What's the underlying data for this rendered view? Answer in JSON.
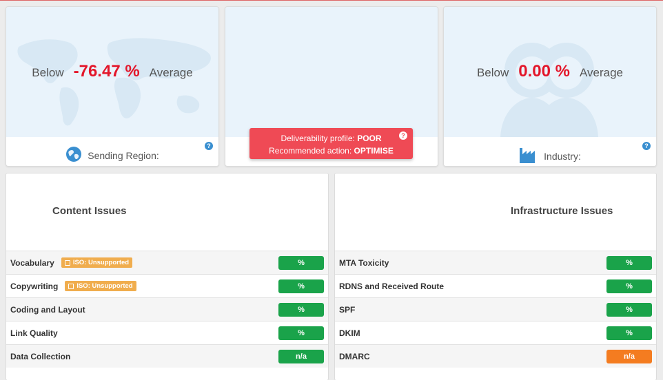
{
  "region_card": {
    "prefix": "Below",
    "value": "-76.47 %",
    "suffix": "Average",
    "label": "Sending Region:",
    "icon": "globe-icon",
    "help": "?"
  },
  "profile_card": {
    "line1_label": "Deliverability profile:",
    "line1_value": "POOR",
    "line2_label": "Recommended action:",
    "line2_value": "OPTIMISE",
    "help": "?"
  },
  "industry_card": {
    "prefix": "Below",
    "value": "0.00 %",
    "suffix": "Average",
    "label": "Industry:",
    "icon": "factory-icon",
    "help": "?"
  },
  "content_issues": {
    "title": "Content Issues",
    "rows": [
      {
        "label": "Vocabulary",
        "badge": "ISO: Unsupported",
        "value": "%",
        "status": "green"
      },
      {
        "label": "Copywriting",
        "badge": "ISO: Unsupported",
        "value": "%",
        "status": "green"
      },
      {
        "label": "Coding and Layout",
        "badge": "",
        "value": "%",
        "status": "green"
      },
      {
        "label": "Link Quality",
        "badge": "",
        "value": "%",
        "status": "green"
      },
      {
        "label": "Data Collection",
        "badge": "",
        "value": "n/a",
        "status": "green"
      }
    ]
  },
  "infrastructure_issues": {
    "title": "Infrastructure Issues",
    "rows": [
      {
        "label": "MTA Toxicity",
        "value": "%",
        "status": "green"
      },
      {
        "label": "RDNS and Received Route",
        "value": "%",
        "status": "green"
      },
      {
        "label": "SPF",
        "value": "%",
        "status": "green"
      },
      {
        "label": "DKIM",
        "value": "%",
        "status": "green"
      },
      {
        "label": "DMARC",
        "value": "n/a",
        "status": "orange"
      }
    ]
  },
  "colors": {
    "green": "#1aa34a",
    "orange": "#f47c20",
    "negative": "#e3162a",
    "alert": "#ef4a55",
    "badge": "#f0ad4e"
  }
}
